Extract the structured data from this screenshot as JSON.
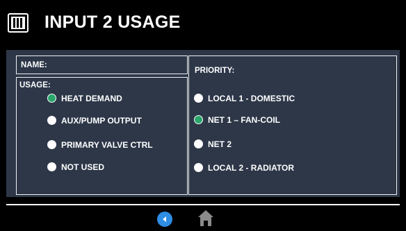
{
  "header": {
    "title": "INPUT 2 USAGE",
    "logo_icon": "wm-logo-icon"
  },
  "name_panel": {
    "label": "NAME:"
  },
  "usage_panel": {
    "label": "USAGE:",
    "options": [
      {
        "label": "HEAT DEMAND",
        "selected": true
      },
      {
        "label": "AUX/PUMP OUTPUT",
        "selected": false
      },
      {
        "label": "PRIMARY VALVE CTRL",
        "selected": false
      },
      {
        "label": "NOT USED",
        "selected": false
      }
    ]
  },
  "priority_panel": {
    "label": "PRIORITY:",
    "options": [
      {
        "label": "LOCAL 1 - DOMESTIC",
        "selected": false
      },
      {
        "label": "NET 1 – FAN-COIL",
        "selected": true
      },
      {
        "label": "NET 2",
        "selected": false
      },
      {
        "label": "LOCAL 2 - RADIATOR",
        "selected": false
      }
    ]
  },
  "footer": {
    "back_icon": "back-arrow-icon",
    "home_icon": "home-icon"
  },
  "colors": {
    "panel_bg": "#2d3748",
    "selected": "#2aa66a",
    "back_button": "#2f8de4"
  }
}
